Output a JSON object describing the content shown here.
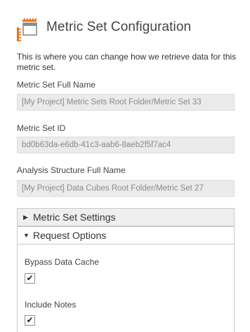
{
  "header": {
    "title": "Metric Set Configuration",
    "icon": "metric-set-config-icon",
    "accent_color": "#e8731a"
  },
  "description": "This is where you can change how we retrieve data for this metric set.",
  "fields": [
    {
      "label": "Metric Set Full Name",
      "value": "[My Project] Metric Sets Root Folder/Metric Set 33"
    },
    {
      "label": "Metric Set ID",
      "value": "bd0b63da-e6db-41c3-aab6-8aeb2f5f7ac4"
    },
    {
      "label": "Analysis Structure Full Name",
      "value": "[My Project] Data Cubes Root Folder/Metric Set 27"
    }
  ],
  "sections": {
    "metric_set_settings": {
      "label": "Metric Set Settings",
      "expanded": false
    },
    "request_options": {
      "label": "Request Options",
      "expanded": true,
      "options": [
        {
          "label": "Bypass Data Cache",
          "checked": true
        },
        {
          "label": "Include Notes",
          "checked": true
        }
      ]
    }
  }
}
